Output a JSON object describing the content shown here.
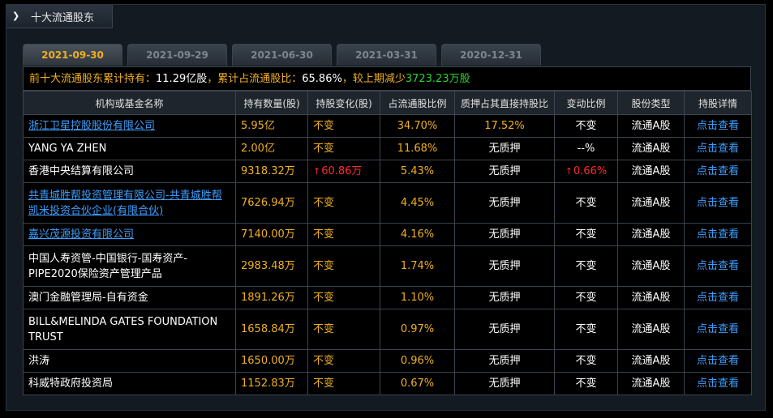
{
  "panel": {
    "title": "十大流通股东",
    "arrow": "❯"
  },
  "tabs": [
    {
      "label": "2021-09-30",
      "active": true
    },
    {
      "label": "2021-09-29",
      "active": false
    },
    {
      "label": "2021-06-30",
      "active": false
    },
    {
      "label": "2021-03-31",
      "active": false
    },
    {
      "label": "2020-12-31",
      "active": false
    }
  ],
  "summary": {
    "prefix": "前十大流通股东累计持有：",
    "holding": "11.29亿股",
    "mid": "，累计占流通股比：",
    "ratio": "65.86%",
    "suffix": "，较上期减少",
    "change": "3723.23万股"
  },
  "columns": [
    "机构或基金名称",
    "持有数量(股)",
    "持股变化(股)",
    "占流通股比例",
    "质押占其直接持股比",
    "变动比例",
    "股份类型",
    "持股详情"
  ],
  "rows": [
    {
      "name": "浙江卫星控股股份有限公司",
      "link": true,
      "qty": "5.95亿",
      "chg": "不变",
      "chg_up": false,
      "ratio": "34.70%",
      "pledge": "17.52%",
      "vr": "不变",
      "vr_up": false,
      "type": "流通A股",
      "detail": "点击查看"
    },
    {
      "name": "YANG YA ZHEN",
      "link": false,
      "qty": "2.00亿",
      "chg": "不变",
      "chg_up": false,
      "ratio": "11.68%",
      "pledge": "无质押",
      "vr": "--%",
      "vr_up": false,
      "type": "流通A股",
      "detail": "点击查看"
    },
    {
      "name": "香港中央结算有限公司",
      "link": false,
      "qty": "9318.32万",
      "chg": "60.86万",
      "chg_up": true,
      "ratio": "5.43%",
      "pledge": "无质押",
      "vr": "0.66%",
      "vr_up": true,
      "type": "流通A股",
      "detail": "点击查看"
    },
    {
      "name": "共青城胜帮投资管理有限公司-共青城胜帮凯米投资合伙企业(有限合伙)",
      "link": true,
      "qty": "7626.94万",
      "chg": "不变",
      "chg_up": false,
      "ratio": "4.45%",
      "pledge": "无质押",
      "vr": "不变",
      "vr_up": false,
      "type": "流通A股",
      "detail": "点击查看"
    },
    {
      "name": "嘉兴茂源投资有限公司",
      "link": true,
      "qty": "7140.00万",
      "chg": "不变",
      "chg_up": false,
      "ratio": "4.16%",
      "pledge": "无质押",
      "vr": "不变",
      "vr_up": false,
      "type": "流通A股",
      "detail": "点击查看"
    },
    {
      "name": "中国人寿资管-中国银行-国寿资产-PIPE2020保险资产管理产品",
      "link": false,
      "qty": "2983.48万",
      "chg": "不变",
      "chg_up": false,
      "ratio": "1.74%",
      "pledge": "无质押",
      "vr": "不变",
      "vr_up": false,
      "type": "流通A股",
      "detail": "点击查看"
    },
    {
      "name": "澳门金融管理局-自有资金",
      "link": false,
      "qty": "1891.26万",
      "chg": "不变",
      "chg_up": false,
      "ratio": "1.10%",
      "pledge": "无质押",
      "vr": "不变",
      "vr_up": false,
      "type": "流通A股",
      "detail": "点击查看"
    },
    {
      "name": "BILL&MELINDA GATES FOUNDATION TRUST",
      "link": false,
      "qty": "1658.84万",
      "chg": "不变",
      "chg_up": false,
      "ratio": "0.97%",
      "pledge": "无质押",
      "vr": "不变",
      "vr_up": false,
      "type": "流通A股",
      "detail": "点击查看"
    },
    {
      "name": "洪涛",
      "link": false,
      "qty": "1650.00万",
      "chg": "不变",
      "chg_up": false,
      "ratio": "0.96%",
      "pledge": "无质押",
      "vr": "不变",
      "vr_up": false,
      "type": "流通A股",
      "detail": "点击查看"
    },
    {
      "name": "科威特政府投资局",
      "link": false,
      "qty": "1152.83万",
      "chg": "不变",
      "chg_up": false,
      "ratio": "0.67%",
      "pledge": "无质押",
      "vr": "不变",
      "vr_up": false,
      "type": "流通A股",
      "detail": "点击查看"
    }
  ]
}
